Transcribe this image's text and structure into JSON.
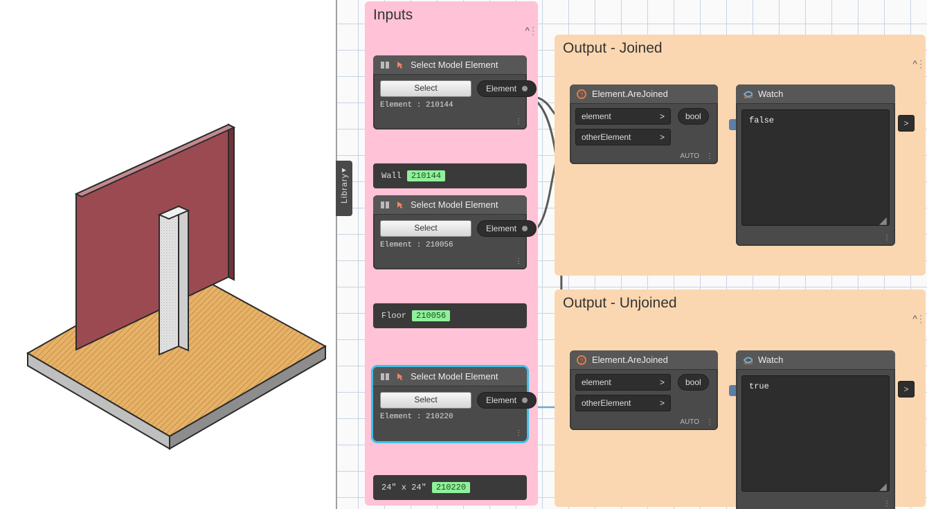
{
  "library_tab": {
    "label": "Library",
    "chevron": "▸"
  },
  "groups": {
    "inputs": {
      "title": "Inputs"
    },
    "out_joined": {
      "title": "Output - Joined"
    },
    "out_unjoined": {
      "title": "Output - Unjoined"
    }
  },
  "nodes": {
    "sel1": {
      "title": "Select Model Element",
      "button": "Select",
      "out_port": "Element",
      "status": "Element : 210144"
    },
    "sel2": {
      "title": "Select Model Element",
      "button": "Select",
      "out_port": "Element",
      "status": "Element : 210056"
    },
    "sel3": {
      "title": "Select Model Element",
      "button": "Select",
      "out_port": "Element",
      "status": "Element : 210220"
    },
    "info1": {
      "label": "Wall",
      "id": "210144"
    },
    "info2": {
      "label": "Floor",
      "id": "210056"
    },
    "info3": {
      "label": "24\" x 24\"",
      "id": "210220"
    },
    "join1": {
      "title": "Element.AreJoined",
      "in1": "element",
      "in2": "otherElement",
      "out": "bool",
      "lacing": "AUTO"
    },
    "join2": {
      "title": "Element.AreJoined",
      "in1": "element",
      "in2": "otherElement",
      "out": "bool",
      "lacing": "AUTO"
    },
    "watch1": {
      "title": "Watch",
      "value": "false"
    },
    "watch2": {
      "title": "Watch",
      "value": "true"
    }
  },
  "icons": {
    "chev_in": ">",
    "chev_up": "^",
    "dots": "⋮"
  }
}
